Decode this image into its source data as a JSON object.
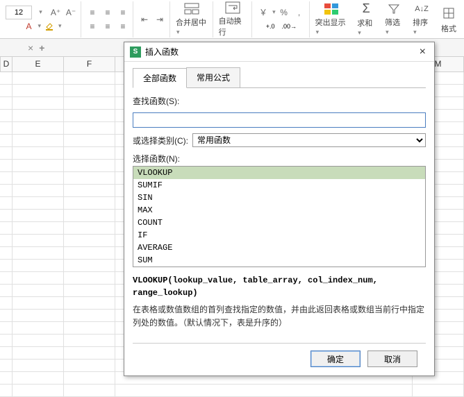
{
  "ribbon": {
    "font_size": "12",
    "merge_label": "合并居中",
    "wrap_label": "自动换行",
    "currency_symbol": "￥",
    "percent_symbol": "%",
    "dec_inc": ".00",
    "dec_dec": ".00",
    "highlight": "突出显示",
    "sum": "求和",
    "filter": "筛选",
    "sort": "排序",
    "format": "格式"
  },
  "columns": [
    "D",
    "E",
    "F",
    "",
    "",
    "",
    "",
    "",
    "M"
  ],
  "dialog": {
    "title": "插入函数",
    "tabs": {
      "all": "全部函数",
      "common": "常用公式"
    },
    "search_label": "查找函数(S):",
    "category_label": "或选择类别(C):",
    "category_value": "常用函数",
    "select_label": "选择函数(N):",
    "functions": [
      "VLOOKUP",
      "SUMIF",
      "SIN",
      "MAX",
      "COUNT",
      "IF",
      "AVERAGE",
      "SUM"
    ],
    "selected": "VLOOKUP",
    "signature": "VLOOKUP(lookup_value, table_array, col_index_num, range_lookup)",
    "description": "在表格或数值数组的首列查找指定的数值，并由此返回表格或数组当前行中指定列处的数值。（默认情况下，表是升序的）",
    "ok": "确定",
    "cancel": "取消"
  }
}
